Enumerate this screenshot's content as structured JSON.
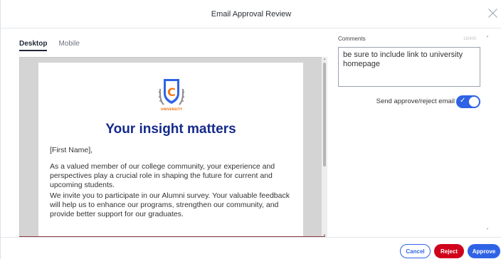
{
  "modal": {
    "title": "Email Approval Review"
  },
  "tabs": [
    {
      "label": "Desktop",
      "active": true
    },
    {
      "label": "Mobile",
      "active": false
    }
  ],
  "email": {
    "logo_text": "UNIVERSITY",
    "logo_letter": "C",
    "headline": "Your insight matters",
    "greeting": "[First Name],",
    "paragraph_1": "As a valued member of our college community, your experience and perspectives play a crucial role in shaping the future for current and upcoming students.",
    "paragraph_2": "We invite you to participate in our Alumni survey. Your valuable feedback will help us to enhance our programs, strengthen  our community, and provide better support for our graduates."
  },
  "comments": {
    "label": "Comments",
    "counter": "18/400",
    "value": "be sure to include link to university homepage"
  },
  "toggle": {
    "label": "Send approve/reject email",
    "on": true
  },
  "footer": {
    "cancel": "Cancel",
    "reject": "Reject",
    "approve": "Approve"
  },
  "colors": {
    "primary": "#2f63e6",
    "danger": "#d0021b",
    "headline": "#152a8a",
    "logo_orange": "#f07a1a"
  },
  "icons": {
    "close": "close-icon",
    "check": "check-icon",
    "logo": "university-shield-logo"
  }
}
